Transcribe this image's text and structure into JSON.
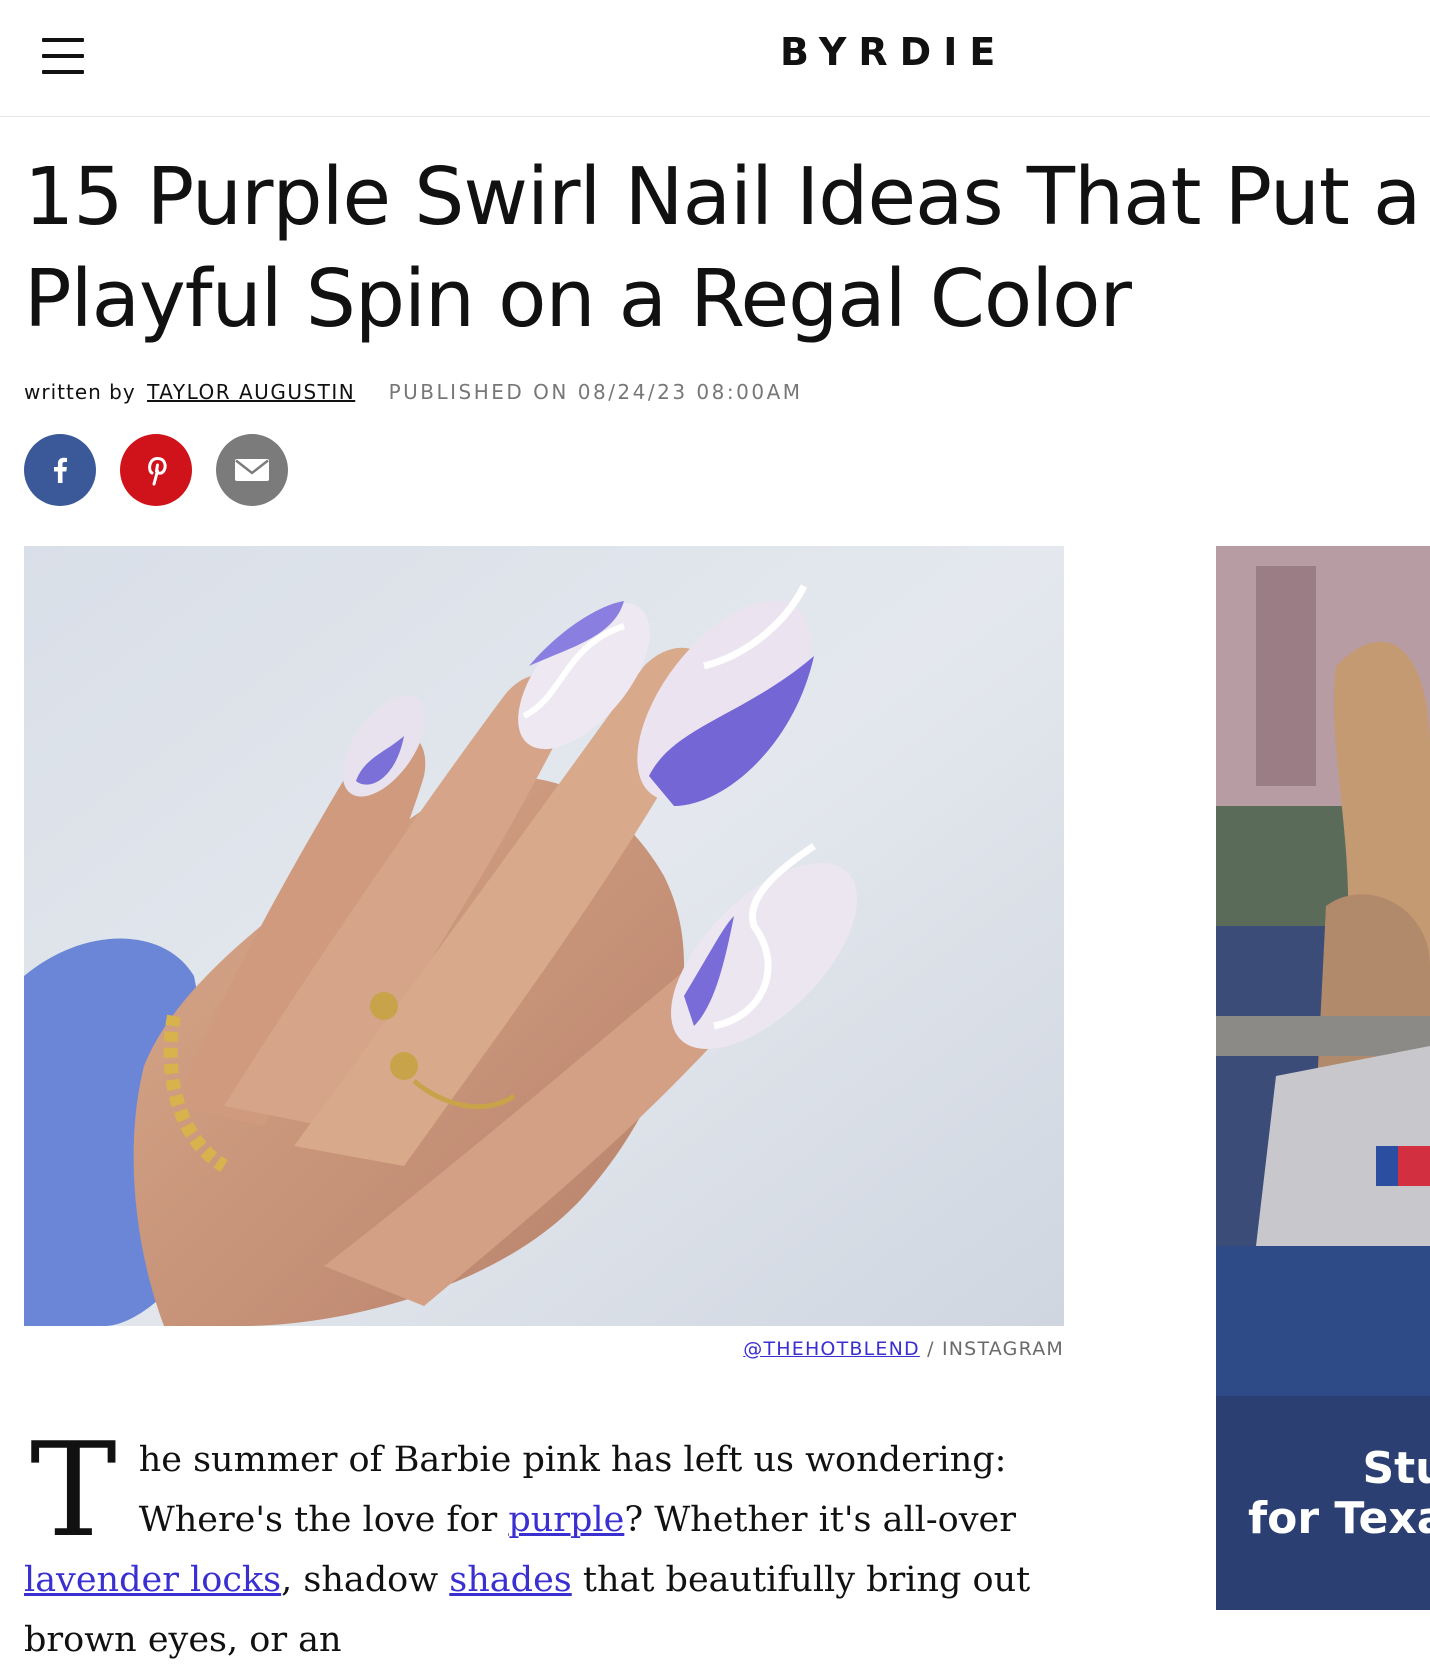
{
  "header": {
    "menu_icon": "hamburger-menu-icon",
    "logo": "BYRDIE"
  },
  "article": {
    "title": "15 Purple Swirl Nail Ideas That Put a Playful Spin on a Regal Color",
    "written_by_label": "written by",
    "author": "TAYLOR AUGUSTIN",
    "published": "PUBLISHED ON 08/24/23 08:00AM"
  },
  "share": {
    "facebook_icon": "facebook-icon",
    "pinterest_icon": "pinterest-icon",
    "email_icon": "email-icon",
    "colors": {
      "facebook": "#3b5998",
      "pinterest": "#d0121b",
      "email": "#7b7b7b"
    }
  },
  "hero": {
    "caption_handle": "@THEHOTBLEND",
    "caption_sep": " / ",
    "caption_source": "INSTAGRAM"
  },
  "ad": {
    "line1": "Stu",
    "line2": "for Texa"
  },
  "body": {
    "dropcap": "T",
    "p1": "he summer of Barbie pink has left us wondering: Where's the love for ",
    "link1": "purple",
    "p2": "? Whether it's all-over ",
    "link2": "lavender locks",
    "p3": ", shadow ",
    "link3": "shades",
    "p4": " that beautifully bring out brown eyes, or an",
    "link_color": "#3a2fd0"
  }
}
